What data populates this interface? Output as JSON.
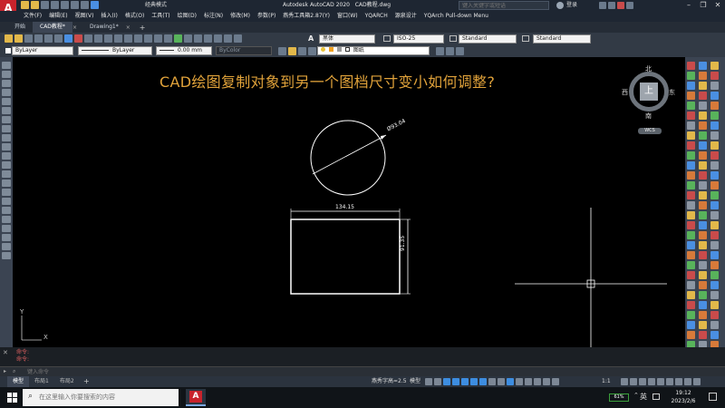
{
  "titlebar": {
    "app_title": "Autodesk AutoCAD 2020",
    "file_name": "CAD教程.dwg",
    "workspace": "经典模式",
    "search_placeholder": "键入关键字或短语",
    "login": "登录",
    "logo": "A"
  },
  "menu": [
    "文件(F)",
    "编辑(E)",
    "视图(V)",
    "插入(I)",
    "格式(O)",
    "工具(T)",
    "绘图(D)",
    "标注(N)",
    "修改(M)",
    "参数(P)",
    "燕秀工具箱2.87(Y)",
    "窗口(W)",
    "YQARCH",
    "源泉设计",
    "YQArch Pull-down Menu"
  ],
  "tabs": [
    {
      "label": "开始",
      "active": false
    },
    {
      "label": "CAD教程*",
      "active": true
    },
    {
      "label": "Drawing1*",
      "active": false
    }
  ],
  "toolbar1": {
    "font": "黑体",
    "dimstyle": "ISO-25",
    "textstyle": "Standard",
    "tablestyle": "Standard"
  },
  "toolbar2": {
    "layer": "ByLayer",
    "linetype": "ByLayer",
    "lineweight": "0.00 mm",
    "plotstyle": "ByColor",
    "layer_name": "图纸"
  },
  "canvas": {
    "heading": "CAD绘图复制对象到另一个图档尺寸变小如何调整?",
    "diameter_dim": "Ø93.04",
    "width_dim": "134.15",
    "height_dim": "91.35",
    "ucs_y": "Y",
    "ucs_x": "X"
  },
  "viewcube": {
    "north": "北",
    "south": "南",
    "west": "西",
    "east": "东",
    "face": "上",
    "wcs": "WCS"
  },
  "command": {
    "history": [
      "命令:",
      "命令:"
    ],
    "placeholder": "键入命令"
  },
  "status": {
    "layout_tabs": [
      "模型",
      "布局1",
      "布局2"
    ],
    "annotation_text": "燕秀字高=2.5",
    "model_label": "模型",
    "scale": "1:1"
  },
  "taskbar": {
    "search_placeholder": "在这里输入你要搜索的内容",
    "battery": "61%",
    "ime": "英",
    "time": "19:12",
    "date": "2023/2/6"
  },
  "colors": {
    "heading": "#e0a23a",
    "accent": "#3d8de0"
  }
}
